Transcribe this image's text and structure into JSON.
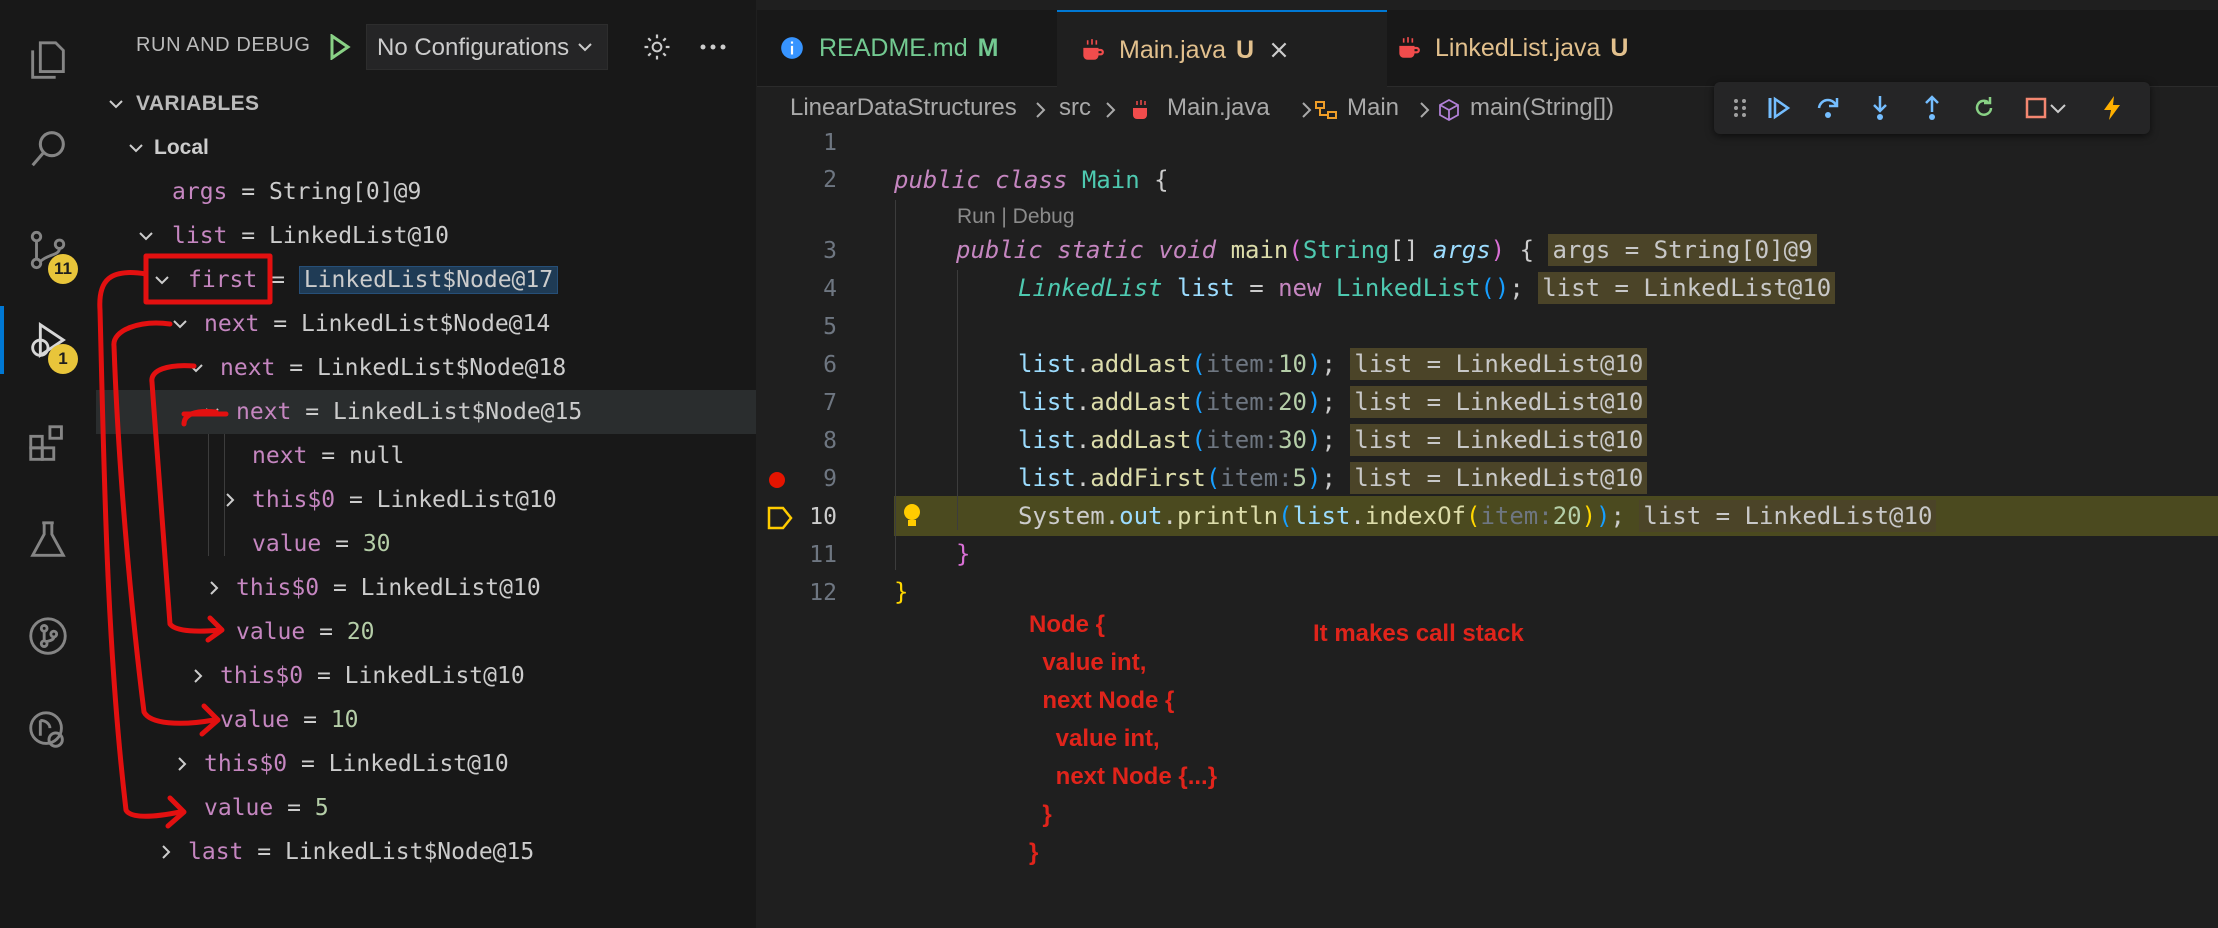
{
  "activity_bar": {
    "items": [
      {
        "name": "explorer-icon"
      },
      {
        "name": "search-icon"
      },
      {
        "name": "source-control-icon",
        "badge": "11"
      },
      {
        "name": "run-debug-icon",
        "badge": "1",
        "active": true
      },
      {
        "name": "extensions-icon"
      },
      {
        "name": "testing-icon"
      },
      {
        "name": "git-graph-icon"
      },
      {
        "name": "remote-explorer-icon"
      }
    ]
  },
  "sidebar": {
    "title": "RUN AND DEBUG",
    "config": "No Configurations",
    "section": "VARIABLES",
    "rows": [
      {
        "name": "Local",
        "eq": "",
        "val": ""
      },
      {
        "name": "args",
        "eq": "=",
        "val": "String[0]@9"
      },
      {
        "name": "list",
        "eq": "=",
        "val": "LinkedList@10"
      },
      {
        "name": "first",
        "eq": "=",
        "val": "LinkedList$Node@17"
      },
      {
        "name": "next",
        "eq": "=",
        "val": "LinkedList$Node@14"
      },
      {
        "name": "next",
        "eq": "=",
        "val": "LinkedList$Node@18"
      },
      {
        "name": "next",
        "eq": "=",
        "val": "LinkedList$Node@15"
      },
      {
        "name": "next",
        "eq": "=",
        "val": "null"
      },
      {
        "name": "this$0",
        "eq": "=",
        "val": "LinkedList@10"
      },
      {
        "name": "value",
        "eq": "=",
        "val": "30"
      },
      {
        "name": "this$0",
        "eq": "=",
        "val": "LinkedList@10"
      },
      {
        "name": "value",
        "eq": "=",
        "val": "20"
      },
      {
        "name": "this$0",
        "eq": "=",
        "val": "LinkedList@10"
      },
      {
        "name": "value",
        "eq": "=",
        "val": "10"
      },
      {
        "name": "this$0",
        "eq": "=",
        "val": "LinkedList@10"
      },
      {
        "name": "value",
        "eq": "=",
        "val": "5"
      },
      {
        "name": "last",
        "eq": "=",
        "val": "LinkedList$Node@15"
      }
    ]
  },
  "tabs": [
    {
      "label": "README.md",
      "status": "M",
      "color": "#4ec9b0",
      "status_color": "#73c991"
    },
    {
      "label": "Main.java",
      "status": "U",
      "color": "#e2c08d",
      "active": true,
      "status_color": "#e2c08d"
    },
    {
      "label": "LinkedList.java",
      "status": "U",
      "color": "#e2c08d",
      "status_color": "#e2c08d"
    }
  ],
  "breadcrumbs": [
    "LinearDataStructures",
    "src",
    "Main.java",
    "Main",
    "main(String[])"
  ],
  "codelens": "Run | Debug",
  "line_numbers": [
    "1",
    "2",
    "3",
    "4",
    "5",
    "6",
    "7",
    "8",
    "9",
    "10",
    "11",
    "12"
  ],
  "code": {
    "l2_kw1": "public",
    "l2_kw2": "class",
    "l2_cls": "Main",
    "l2_brace": "{",
    "l3_kw1": "public",
    "l3_kw2": "static",
    "l3_kw3": "void",
    "l3_fn": "main",
    "l3_type": "String",
    "l3_arr": "[]",
    "l3_prm": "args",
    "l3_inline": "args = String[0]@9",
    "l4_cls": "LinkedList",
    "l4_var": "list",
    "l4_new": "new",
    "l4_ctor": "LinkedList",
    "l4_inline": "list = LinkedList@10",
    "l6_hint": "item:",
    "l6_num": "10",
    "l7_num": "20",
    "l8_num": "30",
    "l9_num": "5",
    "m_addLast": "addLast",
    "m_addFirst": "addFirst",
    "list_var": "list",
    "inline_list": "list = LinkedList@10",
    "l10_sys": "System",
    "l10_out": "out",
    "l10_println": "println",
    "l10_indexOf": "indexOf",
    "l10_hint": "item:",
    "l10_num": "20",
    "close_brace": "}"
  },
  "notes": {
    "node": "Node {\n  value int,\n  next Node {\n    value int,\n    next Node {...}\n  }\n}",
    "callstack": "It makes call stack"
  },
  "colors": {
    "accent": "#0078d4",
    "annotation": "#e0241b",
    "badge": "#e8c53a",
    "breakpoint": "#e51400"
  }
}
